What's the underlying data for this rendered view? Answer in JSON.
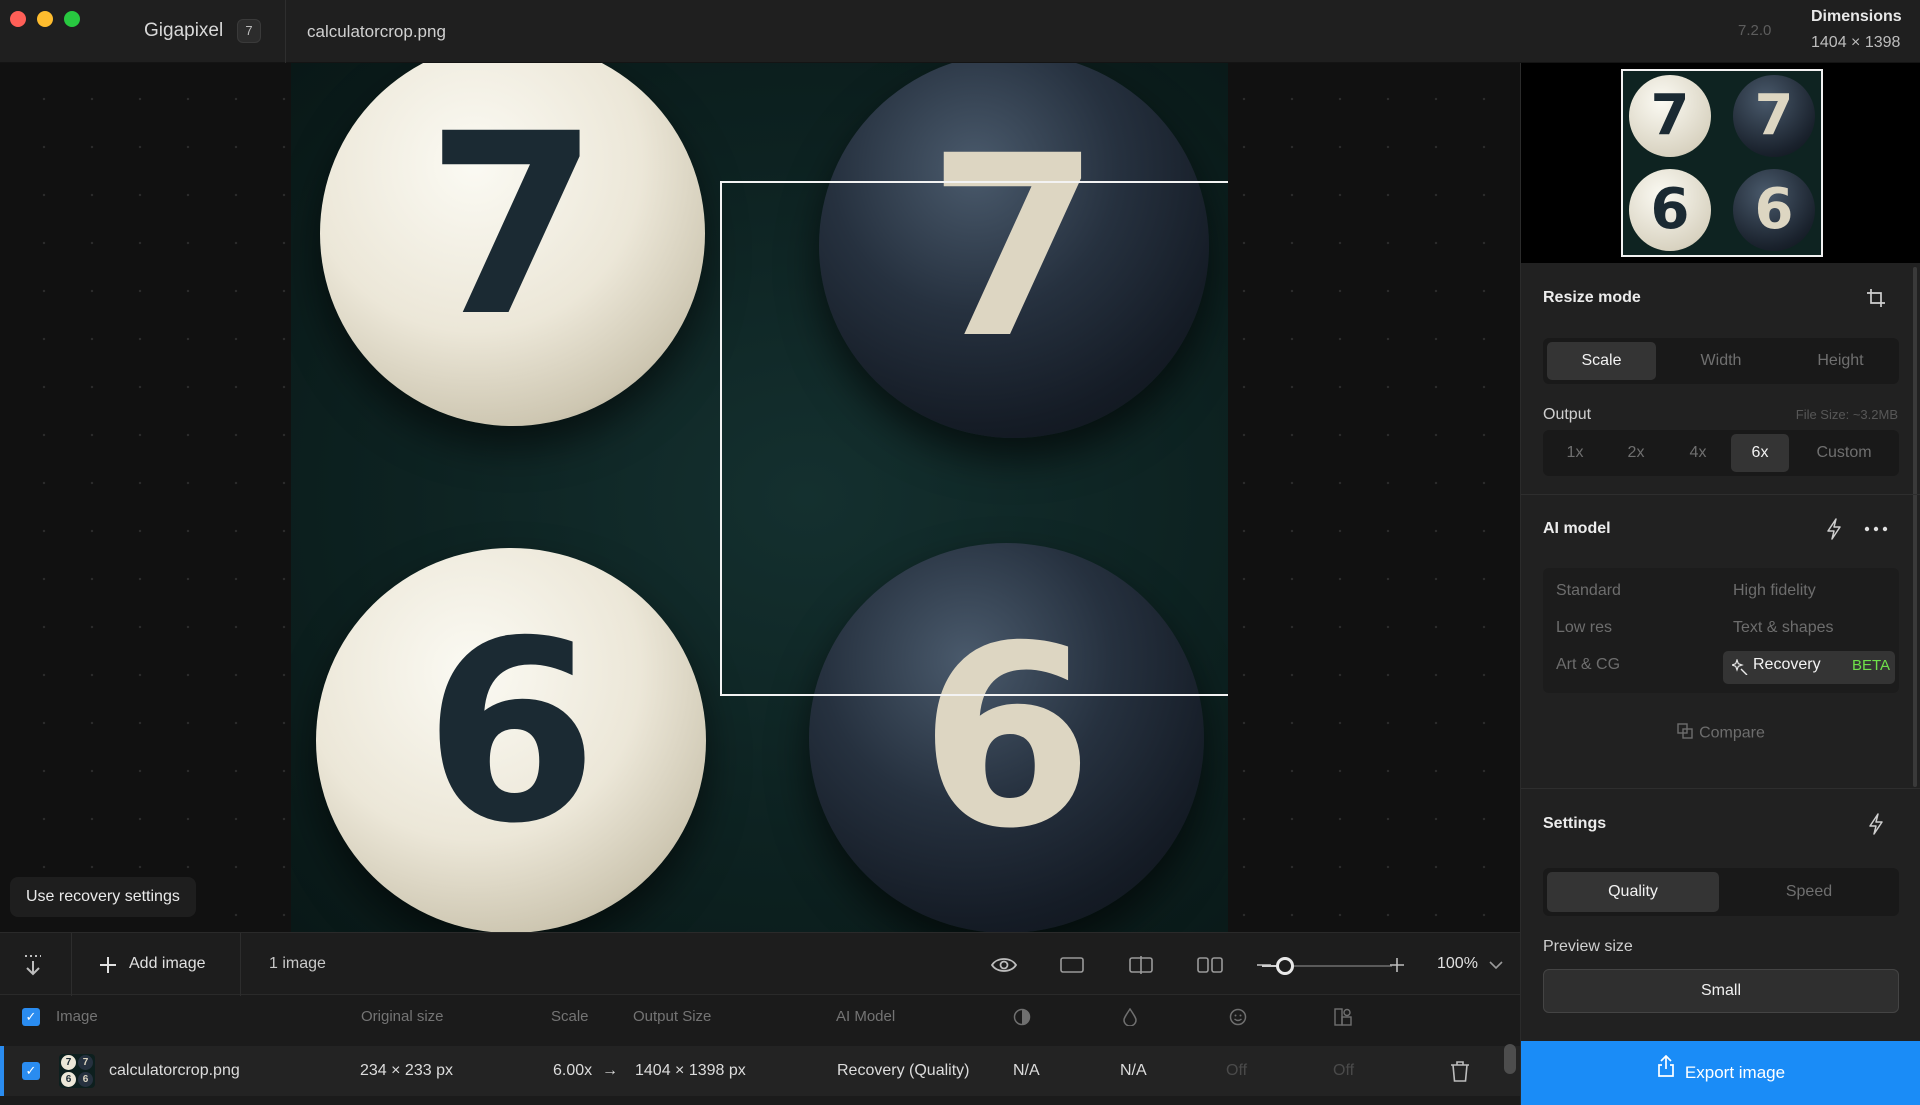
{
  "titlebar": {
    "app_name": "Gigapixel",
    "app_badge": "7",
    "file_name": "calculatorcrop.png",
    "version": "7.2.0",
    "dimensions_label": "Dimensions",
    "dimensions_value": "1404 × 1398"
  },
  "canvas": {
    "keys": [
      "7",
      "7",
      "6",
      "6"
    ],
    "recovery_hint": "Use recovery settings"
  },
  "toolbar": {
    "add_image": "Add image",
    "image_count": "1 image",
    "zoom_level": "100%",
    "zoom_fraction": 0.12
  },
  "table": {
    "headers": {
      "image": "Image",
      "original_size": "Original size",
      "scale": "Scale",
      "output_size": "Output Size",
      "ai_model": "AI Model"
    },
    "row": {
      "file_name": "calculatorcrop.png",
      "original_size": "234 × 233 px",
      "scale": "6.00x",
      "arrow": "→",
      "output_size": "1404 × 1398 px",
      "ai_model": "Recovery (Quality)",
      "col_a": "N/A",
      "col_b": "N/A",
      "col_c": "Off",
      "col_d": "Off"
    }
  },
  "panel": {
    "resize_mode": {
      "title": "Resize mode",
      "options": [
        "Scale",
        "Width",
        "Height"
      ],
      "selected": "Scale"
    },
    "output": {
      "label": "Output",
      "file_size": "File Size: ~3.2MB",
      "options": [
        "1x",
        "2x",
        "4x",
        "6x",
        "Custom"
      ],
      "selected": "6x"
    },
    "ai_model": {
      "title": "AI model",
      "models": [
        "Standard",
        "High fidelity",
        "Low res",
        "Text & shapes",
        "Art & CG",
        "Recovery"
      ],
      "selected": "Recovery",
      "beta_tag": "BETA",
      "compare": "Compare"
    },
    "settings": {
      "title": "Settings",
      "options": [
        "Quality",
        "Speed"
      ],
      "selected": "Quality",
      "preview_size_label": "Preview size",
      "preview_size_value": "Small"
    },
    "export_label": "Export image"
  },
  "colors": {
    "accent": "#1a8cf7",
    "beta": "#6ee04a",
    "close": "#ff5f57",
    "minimize": "#febc2e",
    "maximize": "#28c840"
  }
}
